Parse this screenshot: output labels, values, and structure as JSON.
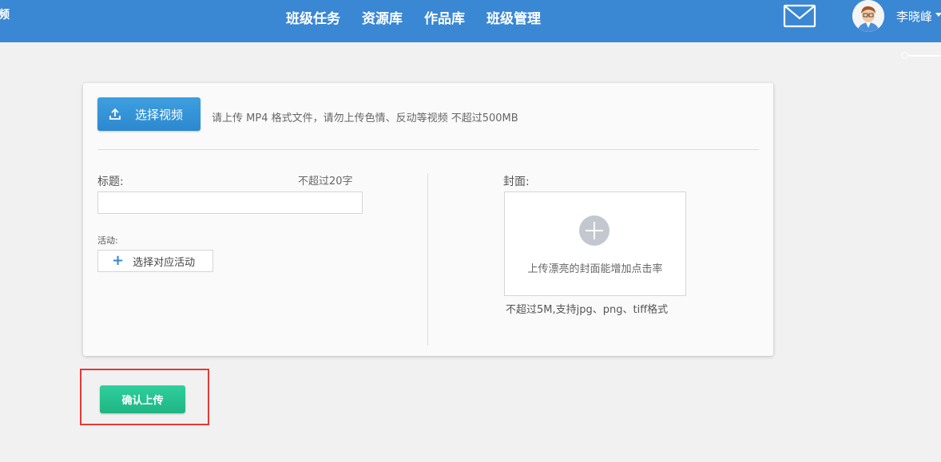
{
  "header": {
    "brand_fragment": "频",
    "nav": [
      "班级任务",
      "资源库",
      "作品库",
      "班级管理"
    ],
    "username": "李晓峰",
    "accent_color": "#3a87d4",
    "icons": [
      "mail-icon",
      "avatar",
      "chevron-down-icon"
    ]
  },
  "upload": {
    "select_video_label": "选择视频",
    "hint": "请上传 MP4 格式文件，请勿上传色情、反动等视频 不超过500MB"
  },
  "form": {
    "title_label": "标题:",
    "title_limit": "不超过20字",
    "title_value": "",
    "activity_label": "活动:",
    "activity_button": "选择对应活动",
    "cover_label": "封面:",
    "cover_hint": "上传漂亮的封面能增加点击率",
    "cover_limit": "不超过5M,支持jpg、png、tiff格式"
  },
  "actions": {
    "confirm_label": "确认上传",
    "confirm_color": "#1fb583",
    "highlight_color": "#e53935"
  }
}
